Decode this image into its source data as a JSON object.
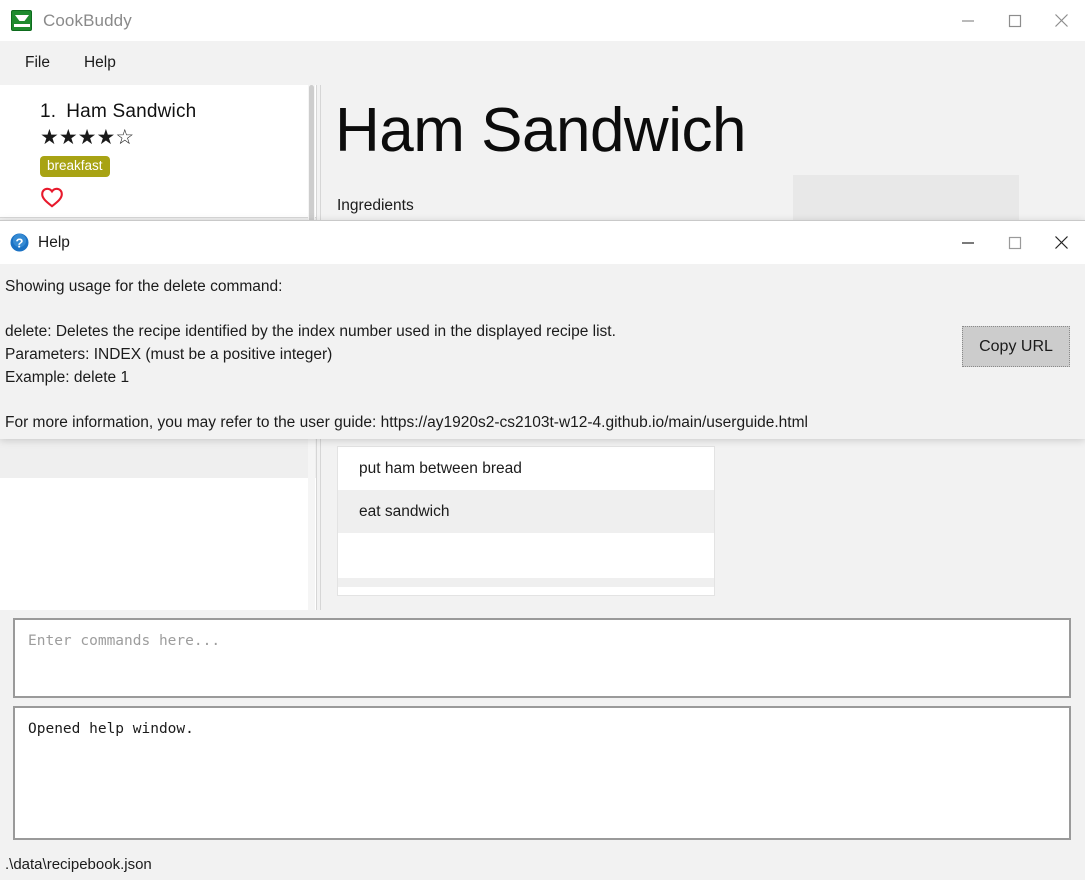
{
  "window": {
    "title": "CookBuddy",
    "icon": "cookbook-icon",
    "controls": {
      "minimize": "minimize-icon",
      "maximize": "maximize-icon",
      "close": "close-icon"
    }
  },
  "menubar": {
    "items": [
      {
        "label": "File"
      },
      {
        "label": "Help"
      }
    ]
  },
  "recipe_list": {
    "items": [
      {
        "index": "1.",
        "name": "Ham Sandwich",
        "rating_filled": "★★★★",
        "rating_empty": "☆",
        "rating_value": 4,
        "rating_max": 5,
        "tags": [
          "breakfast"
        ],
        "favourite": true
      }
    ]
  },
  "detail": {
    "title": "Ham Sandwich",
    "ingredients_label": "Ingredients",
    "steps": [
      {
        "text": "put ham between bread"
      },
      {
        "text": "eat sandwich"
      }
    ]
  },
  "command": {
    "placeholder": "Enter commands here...",
    "value": "",
    "result": "Opened help window."
  },
  "status": {
    "file_path": ".\\data\\recipebook.json"
  },
  "help_dialog": {
    "title": "Help",
    "icon": "question-mark-icon",
    "intro": "Showing usage for the delete command:",
    "usage_lines": [
      "delete: Deletes the recipe identified by the index number used in the displayed recipe list.",
      "Parameters: INDEX (must be a positive integer)",
      "Example: delete 1"
    ],
    "footer": "For more information, you may refer to the user guide: https://ay1920s2-cs2103t-w12-4.github.io/main/userguide.html",
    "user_guide_url": "https://ay1920s2-cs2103t-w12-4.github.io/main/userguide.html",
    "copy_button": "Copy URL",
    "controls": {
      "minimize": "minimize-icon",
      "maximize": "maximize-icon",
      "close": "close-icon"
    }
  },
  "colors": {
    "tag_background": "#a8a314",
    "favourite_heart": "#e8192c",
    "app_icon_green": "#1e8b2e",
    "help_icon_blue": "#1b72c4",
    "window_background": "#f2f2f2"
  }
}
